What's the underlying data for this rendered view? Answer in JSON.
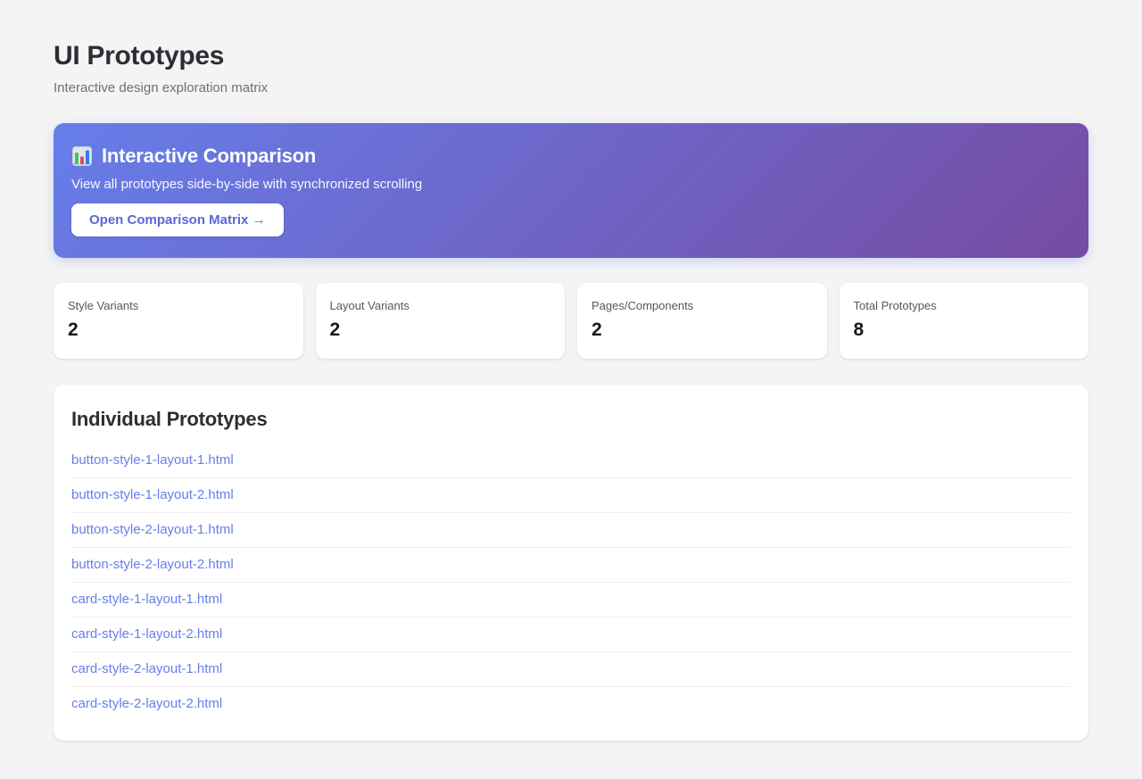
{
  "page": {
    "title": "UI Prototypes",
    "subtitle": "Interactive design exploration matrix"
  },
  "banner": {
    "icon": "bar-chart-icon",
    "title": "Interactive Comparison",
    "description": "View all prototypes side-by-side with synchronized scrolling",
    "button_label": "Open Comparison Matrix →",
    "gradient_start": "#667eea",
    "gradient_end": "#764ba2"
  },
  "stats": [
    {
      "label": "Style Variants",
      "value": "2"
    },
    {
      "label": "Layout Variants",
      "value": "2"
    },
    {
      "label": "Pages/Components",
      "value": "2"
    },
    {
      "label": "Total Prototypes",
      "value": "8"
    }
  ],
  "prototypes": {
    "heading": "Individual Prototypes",
    "links": [
      "button-style-1-layout-1.html",
      "button-style-1-layout-2.html",
      "button-style-2-layout-1.html",
      "button-style-2-layout-2.html",
      "card-style-1-layout-1.html",
      "card-style-1-layout-2.html",
      "card-style-2-layout-1.html",
      "card-style-2-layout-2.html"
    ]
  },
  "colors": {
    "accent": "#5a67d8",
    "link": "#667eea",
    "background": "#f4f4f5"
  }
}
